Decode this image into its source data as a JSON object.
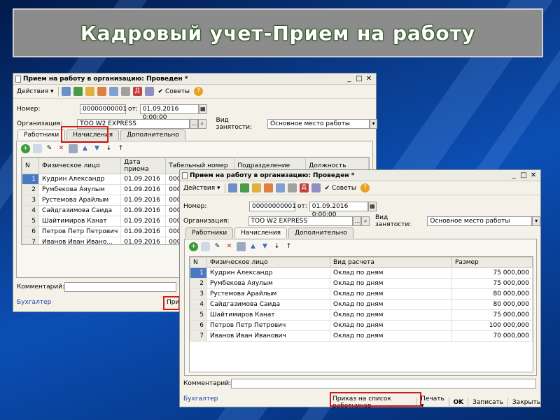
{
  "slide_title": "Кадровый учет-Прием на работу",
  "back_window": {
    "title": "Прием на работу в организацию: Проведен *",
    "toolbar": {
      "actions": "Действия",
      "tips": "Советы"
    },
    "number_label": "Номер:",
    "number_value": "00000000001",
    "from_label": "от:",
    "date_value": "01.09.2016  0:00:00",
    "org_label": "Организация:",
    "org_value": "ТОО W2 EXPRESS",
    "employment_label": "Вид занятости:",
    "employment_value": "Основное место работы",
    "tabs": [
      "Работники",
      "Начисления",
      "Дополнительно"
    ],
    "columns": [
      "N",
      "Физическое лицо",
      "Дата приема",
      "Табельный номер",
      "Подразделение",
      "Должность"
    ],
    "rows": [
      {
        "n": "1",
        "name": "Кудрин Александр",
        "date": "01.09.2016",
        "tab": "0000000"
      },
      {
        "n": "2",
        "name": "Румбекова Аяулым",
        "date": "01.09.2016",
        "tab": "0000000"
      },
      {
        "n": "3",
        "name": "Рустемова Арайлым",
        "date": "01.09.2016",
        "tab": "0000000"
      },
      {
        "n": "4",
        "name": "Сайдгазимова Саида",
        "date": "01.09.2016",
        "tab": "0000000"
      },
      {
        "n": "5",
        "name": "Шайтимиров Канат",
        "date": "01.09.2016",
        "tab": "0000000"
      },
      {
        "n": "6",
        "name": "Петров Петр Петрович",
        "date": "01.09.2016",
        "tab": "0000000"
      },
      {
        "n": "7",
        "name": "Иванов Иван Ивано...",
        "date": "01.09.2016",
        "tab": "0000000"
      }
    ],
    "comment_label": "Комментарий:",
    "accountant": "Бухгалтер",
    "order_partial": "Прика"
  },
  "front_window": {
    "title": "Прием на работу в организацию: Проведен *",
    "toolbar": {
      "actions": "Действия",
      "tips": "Советы"
    },
    "number_label": "Номер:",
    "number_value": "00000000001",
    "from_label": "от:",
    "date_value": "01.09.2016  0:00:00",
    "org_label": "Организация:",
    "org_value": "ТОО W2 EXPRESS",
    "employment_label": "Вид занятости:",
    "employment_value": "Основное место работы",
    "tabs": [
      "Работники",
      "Начисления",
      "Дополнительно"
    ],
    "columns": [
      "N",
      "Физическое лицо",
      "Вид расчета",
      "Размер"
    ],
    "rows": [
      {
        "n": "1",
        "name": "Кудрин Александр",
        "calc": "Оклад по дням",
        "amount": "75 000,000"
      },
      {
        "n": "2",
        "name": "Румбекова Аяулым",
        "calc": "Оклад по дням",
        "amount": "75 000,000"
      },
      {
        "n": "3",
        "name": "Рустемова Арайлым",
        "calc": "Оклад по дням",
        "amount": "80 000,000"
      },
      {
        "n": "4",
        "name": "Сайдгазимова Саида",
        "calc": "Оклад по дням",
        "amount": "80 000,000"
      },
      {
        "n": "5",
        "name": "Шайтимиров Канат",
        "calc": "Оклад по дням",
        "amount": "75 000,000"
      },
      {
        "n": "6",
        "name": "Петров Петр Петрович",
        "calc": "Оклад по дням",
        "amount": "100 000,000"
      },
      {
        "n": "7",
        "name": "Иванов Иван Иванович",
        "calc": "Оклад по дням",
        "amount": "70 000,000"
      }
    ],
    "comment_label": "Комментарий:",
    "accountant": "Бухгалтер",
    "order_button": "Приказ на список работников",
    "print_button": "Печать",
    "ok_button": "OK",
    "save_button": "Записать",
    "close_button": "Закрыть"
  },
  "colors": {
    "highlight": "#d51a1a",
    "selected_row": "#4a78c2"
  }
}
